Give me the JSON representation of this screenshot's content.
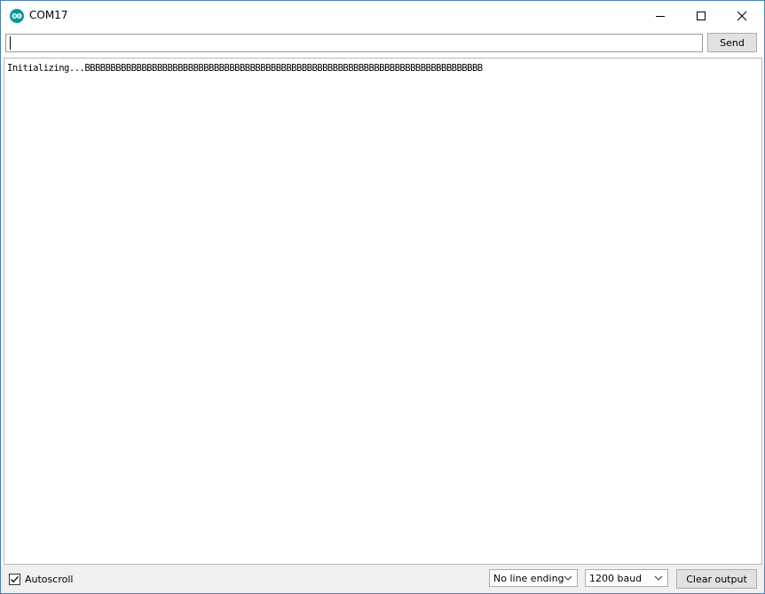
{
  "window": {
    "title": "COM17",
    "app_icon": "arduino-logo-icon",
    "controls": {
      "minimize_icon": "minimize-icon",
      "maximize_icon": "maximize-icon",
      "close_icon": "close-icon"
    }
  },
  "send_bar": {
    "input_value": "",
    "send_label": "Send"
  },
  "output": {
    "text": "Initializing...BBBBBBBBBBBBBBBBBBBBBBBBBBBBBBBBBBBBBBBBBBBBBBBBBBBBBBBBBBBBBBBBBBBBBBBBBBBBB"
  },
  "footer": {
    "autoscroll_label": "Autoscroll",
    "autoscroll_checked": true,
    "line_ending_selected": "No line ending",
    "baud_selected": "1200 baud",
    "clear_label": "Clear output"
  },
  "colors": {
    "brand": "#00979d",
    "window_border": "#4a7fb5",
    "footer_bg": "#f0f0f0",
    "button_bg": "#e1e1e1"
  }
}
